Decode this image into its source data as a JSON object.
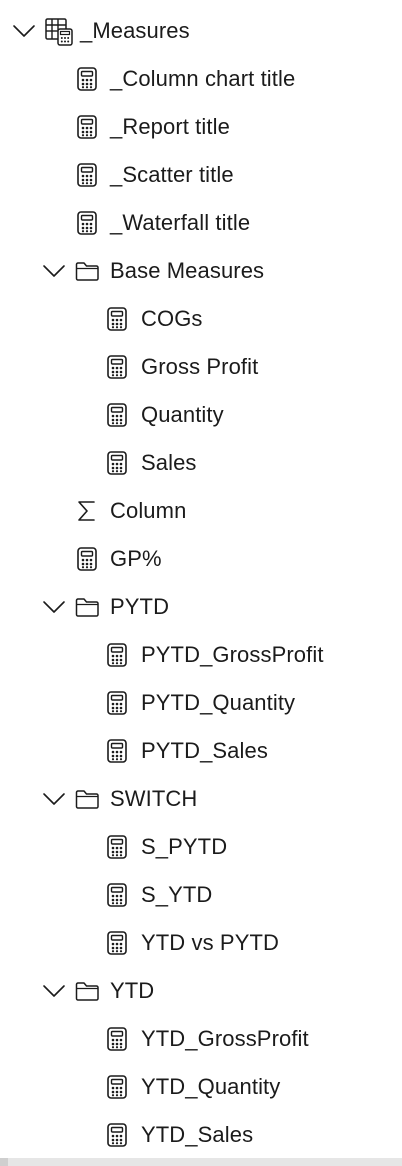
{
  "tree": {
    "table": {
      "label": "_Measures",
      "icon": "table-calculator-icon"
    },
    "measures": [
      {
        "label": "_Column chart title",
        "icon": "calculator-icon"
      },
      {
        "label": "_Report title",
        "icon": "calculator-icon"
      },
      {
        "label": "_Scatter title",
        "icon": "calculator-icon"
      },
      {
        "label": "_Waterfall title",
        "icon": "calculator-icon"
      }
    ],
    "base_measures": {
      "label": "Base Measures",
      "icon": "folder-icon",
      "items": [
        {
          "label": "COGs",
          "icon": "calculator-icon"
        },
        {
          "label": "Gross Profit",
          "icon": "calculator-icon"
        },
        {
          "label": "Quantity",
          "icon": "calculator-icon"
        },
        {
          "label": "Sales",
          "icon": "calculator-icon"
        }
      ]
    },
    "column": {
      "label": "Column",
      "icon": "sigma-icon"
    },
    "gp_percent": {
      "label": "GP%",
      "icon": "calculator-icon"
    },
    "pytd": {
      "label": "PYTD",
      "icon": "folder-icon",
      "items": [
        {
          "label": "PYTD_GrossProfit",
          "icon": "calculator-icon"
        },
        {
          "label": "PYTD_Quantity",
          "icon": "calculator-icon"
        },
        {
          "label": "PYTD_Sales",
          "icon": "calculator-icon"
        }
      ]
    },
    "switch": {
      "label": "SWITCH",
      "icon": "folder-icon",
      "items": [
        {
          "label": "S_PYTD",
          "icon": "calculator-icon"
        },
        {
          "label": "S_YTD",
          "icon": "calculator-icon"
        },
        {
          "label": "YTD vs PYTD",
          "icon": "calculator-icon"
        }
      ]
    },
    "ytd": {
      "label": "YTD",
      "icon": "folder-icon",
      "items": [
        {
          "label": "YTD_GrossProfit",
          "icon": "calculator-icon"
        },
        {
          "label": "YTD_Quantity",
          "icon": "calculator-icon"
        },
        {
          "label": "YTD_Sales",
          "icon": "calculator-icon"
        }
      ]
    }
  },
  "colors": {
    "text": "#1b1b1b",
    "icon_stroke": "#1b1b1b",
    "background": "#ffffff",
    "scrollbar": "#e6e6e6"
  }
}
